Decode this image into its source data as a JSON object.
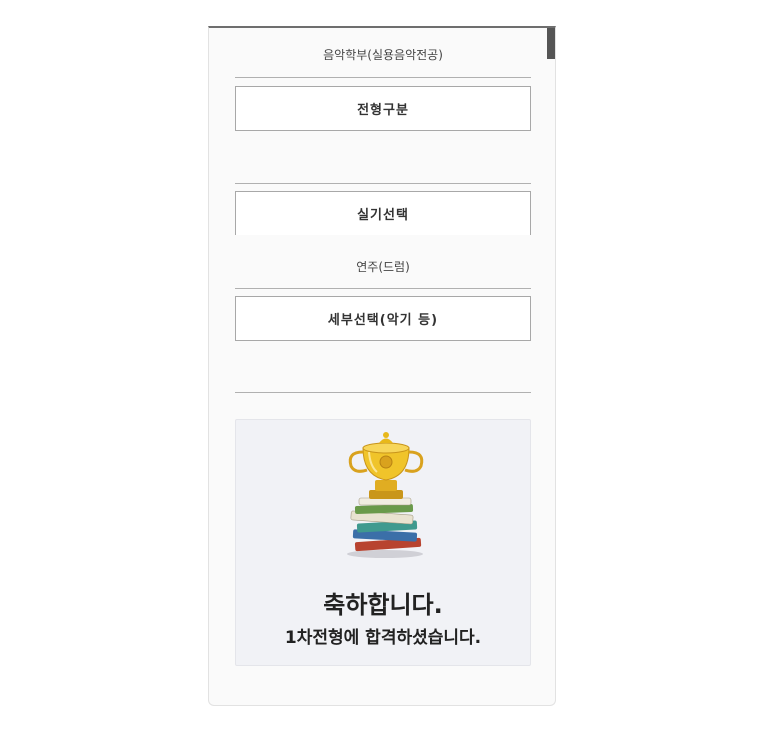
{
  "form": {
    "department_value": "음악학부(실용음악전공)",
    "admission_type_label": "전형구분",
    "admission_type_value": "",
    "practical_label": "실기선택",
    "practical_value": "연주(드럼)",
    "detail_label": "세부선택(악기 등)",
    "detail_value": ""
  },
  "result": {
    "icon": "trophy-on-books-icon",
    "title": "축하합니다.",
    "message": "1차전형에 합격하셨습니다."
  },
  "colors": {
    "panel_bg": "#fafafa",
    "card_bg": "#f1f2f6",
    "border": "#a8a8a8",
    "trophy_gold": "#e8b81a"
  }
}
